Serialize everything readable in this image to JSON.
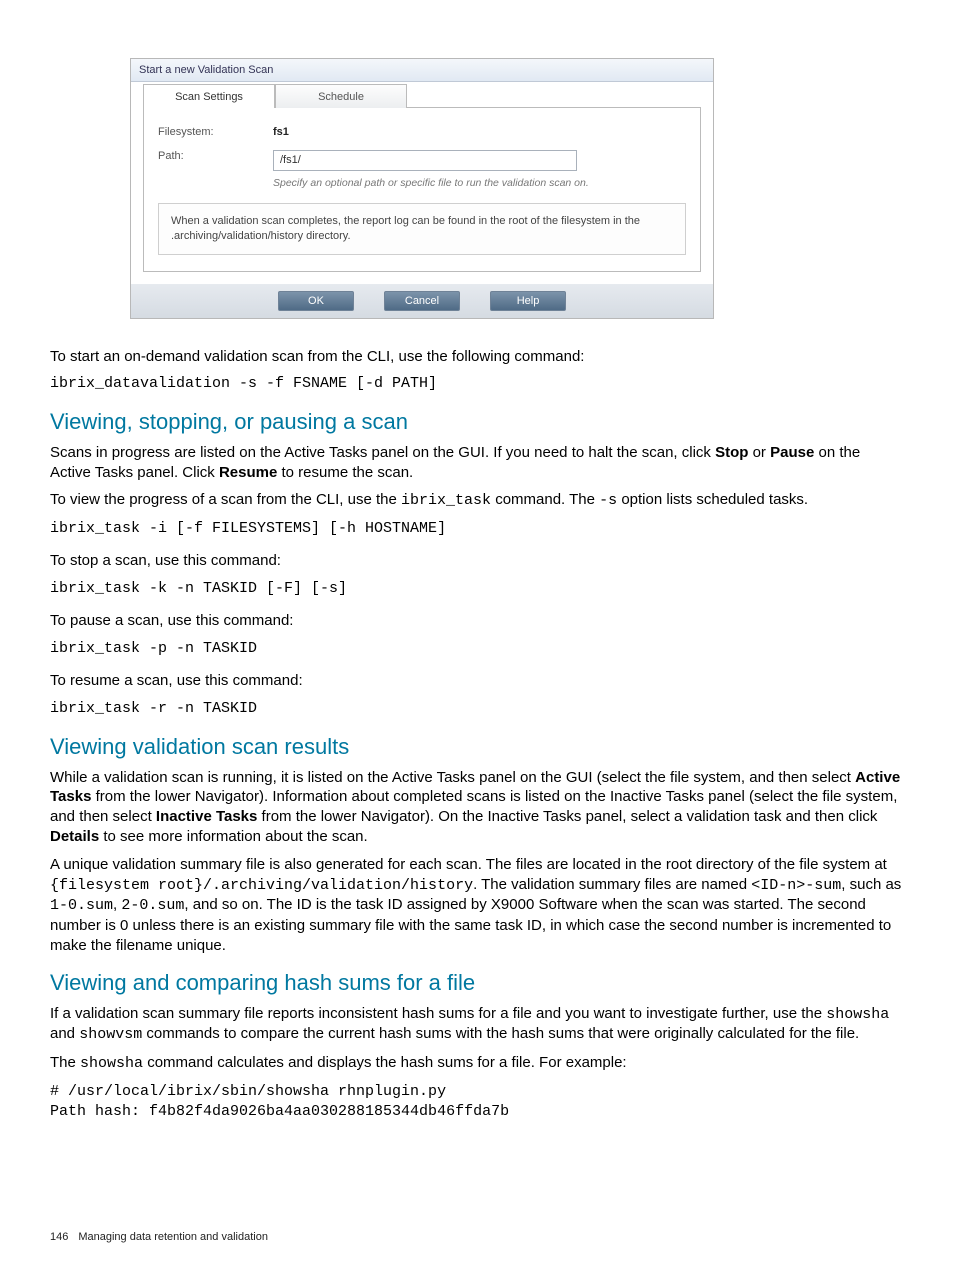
{
  "dialog": {
    "title": "Start a new Validation Scan",
    "tab_settings": "Scan Settings",
    "tab_schedule": "Schedule",
    "fs_label": "Filesystem:",
    "fs_value": "fs1",
    "path_label": "Path:",
    "path_value": "/fs1/",
    "path_hint": "Specify an optional path or specific file to run the validation scan on.",
    "info": "When a validation scan completes, the report log can be found in the root of the filesystem in the .archiving/validation/history directory.",
    "b_ok": "OK",
    "b_cancel": "Cancel",
    "b_help": "Help"
  },
  "body": {
    "p_start_cli": "To start an on-demand validation scan from the CLI, use the following command:",
    "cmd_start": "ibrix_datavalidation -s -f FSNAME [-d PATH]",
    "h_view_stop": "Viewing, stopping, or pausing a scan",
    "p_scans_1a": "Scans in progress are listed on the Active Tasks panel on the GUI. If you need to halt the scan, click ",
    "w_stop": "Stop",
    "p_scans_1b": " or ",
    "w_pause": "Pause",
    "p_scans_1c": " on the Active Tasks panel. Click ",
    "w_resume": "Resume",
    "p_scans_1d": " to resume the scan.",
    "p_scans_2a": "To view the progress of a scan from the CLI, use the ",
    "tt_ibrix_task": "ibrix_task",
    "p_scans_2b": " command. The ",
    "tt_s": "-s",
    "p_scans_2c": " option lists scheduled tasks.",
    "cmd_task_i": "ibrix_task -i [-f FILESYSTEMS] [-h HOSTNAME]",
    "p_stop": "To stop a scan, use this command:",
    "cmd_task_k": "ibrix_task -k -n TASKID [-F] [-s]",
    "p_pause": "To pause a scan, use this command:",
    "cmd_task_p": "ibrix_task -p -n TASKID",
    "p_resume": "To resume a scan, use this command:",
    "cmd_task_r": "ibrix_task -r -n TASKID",
    "h_results": "Viewing validation scan results",
    "p_res_1a": "While a validation scan is running, it is listed on the Active Tasks panel on the GUI (select the file system, and then select ",
    "w_active": "Active Tasks",
    "p_res_1b": " from the lower Navigator). Information about completed scans is listed on the Inactive Tasks panel (select the file system, and then select ",
    "w_inactive": "Inactive Tasks",
    "p_res_1c": " from the lower Navigator). On the Inactive Tasks panel, select a validation task and then click ",
    "w_details": "Details",
    "p_res_1d": " to see more information about the scan.",
    "p_res_2a": "A unique validation summary file is also generated for each scan. The files are located in the root directory of the file system at ",
    "tt_path": "{filesystem root}/.archiving/validation/history",
    "p_res_2b": ". The validation summary files are named ",
    "tt_idn": "<ID-n>-sum",
    "p_res_2c": ", such as ",
    "tt_10": "1-0.sum",
    "p_res_2d": ", ",
    "tt_20": "2-0.sum",
    "p_res_2e": ", and so on. The ID is the task ID assigned by X9000 Software when the scan was started. The second number is 0 unless there is an existing summary file with the same task ID, in which case the second number is incremented to make the filename unique.",
    "h_hash": "Viewing and comparing hash sums for a file",
    "p_hash_1a": "If a validation scan summary file reports inconsistent hash sums for a file and you want to investigate further, use the ",
    "tt_showsha": "showsha",
    "p_hash_1b": " and ",
    "tt_showvsm": "showvsm",
    "p_hash_1c": " commands to compare the current hash sums with the hash sums that were originally calculated for the file.",
    "p_hash_2a": "The ",
    "p_hash_2b": " command calculates and displays the hash sums for a file. For example:",
    "code_hash": "# /usr/local/ibrix/sbin/showsha rhnplugin.py\nPath hash: f4b82f4da9026ba4aa030288185344db46ffda7b"
  },
  "footer": {
    "page_number": "146",
    "chapter": "Managing data retention and validation"
  }
}
